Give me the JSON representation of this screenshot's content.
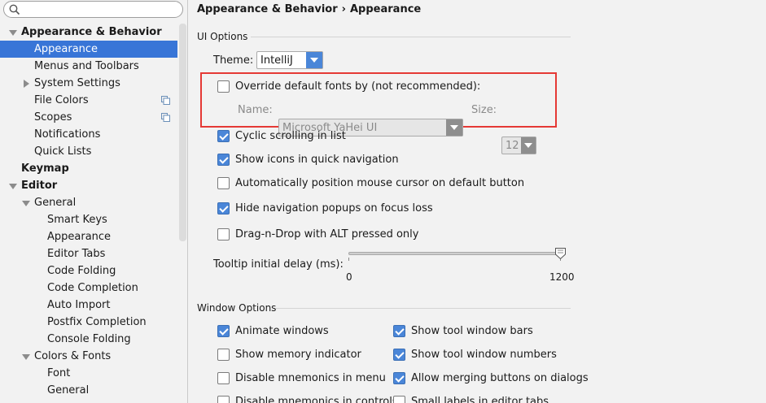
{
  "search": {
    "placeholder": "",
    "icon": "search-icon"
  },
  "sidebar": {
    "items": [
      {
        "label": "Appearance & Behavior"
      },
      {
        "label": "Appearance"
      },
      {
        "label": "Menus and Toolbars"
      },
      {
        "label": "System Settings"
      },
      {
        "label": "File Colors"
      },
      {
        "label": "Scopes"
      },
      {
        "label": "Notifications"
      },
      {
        "label": "Quick Lists"
      },
      {
        "label": "Keymap"
      },
      {
        "label": "Editor"
      },
      {
        "label": "General"
      },
      {
        "label": "Smart Keys"
      },
      {
        "label": "Appearance"
      },
      {
        "label": "Editor Tabs"
      },
      {
        "label": "Code Folding"
      },
      {
        "label": "Code Completion"
      },
      {
        "label": "Auto Import"
      },
      {
        "label": "Postfix Completion"
      },
      {
        "label": "Console Folding"
      },
      {
        "label": "Colors & Fonts"
      },
      {
        "label": "Font"
      },
      {
        "label": "General"
      }
    ]
  },
  "breadcrumb": {
    "parent": "Appearance & Behavior",
    "separator": "›",
    "current": "Appearance"
  },
  "ui_options": {
    "title": "UI Options",
    "theme_label": "Theme:",
    "theme_value": "IntelliJ",
    "override_fonts": {
      "label": "Override default fonts by (not recommended):",
      "checked": false
    },
    "name_label": "Name:",
    "name_value": "Microsoft YaHei UI",
    "size_label": "Size:",
    "size_value": "12",
    "options": [
      {
        "label": "Cyclic scrolling in list",
        "checked": true
      },
      {
        "label": "Show icons in quick navigation",
        "checked": true
      },
      {
        "label": "Automatically position mouse cursor on default button",
        "checked": false
      },
      {
        "label": "Hide navigation popups on focus loss",
        "checked": true
      },
      {
        "label": "Drag-n-Drop with ALT pressed only",
        "checked": false
      }
    ],
    "tooltip_delay": {
      "label": "Tooltip initial delay (ms):",
      "min": "0",
      "max": "1200",
      "value": 1200
    }
  },
  "window_options": {
    "title": "Window Options",
    "left": [
      {
        "label": "Animate windows",
        "checked": true
      },
      {
        "label": "Show memory indicator",
        "checked": false
      },
      {
        "label": "Disable mnemonics in menu",
        "checked": false
      },
      {
        "label": "Disable mnemonics in controls",
        "checked": false
      }
    ],
    "right": [
      {
        "label": "Show tool window bars",
        "checked": true
      },
      {
        "label": "Show tool window numbers",
        "checked": true
      },
      {
        "label": "Allow merging buttons on dialogs",
        "checked": true
      },
      {
        "label": "Small labels in editor tabs",
        "checked": false
      }
    ]
  },
  "colors": {
    "selection": "#3875d7",
    "accent": "#4a86d8",
    "highlight_box": "#e53935"
  }
}
